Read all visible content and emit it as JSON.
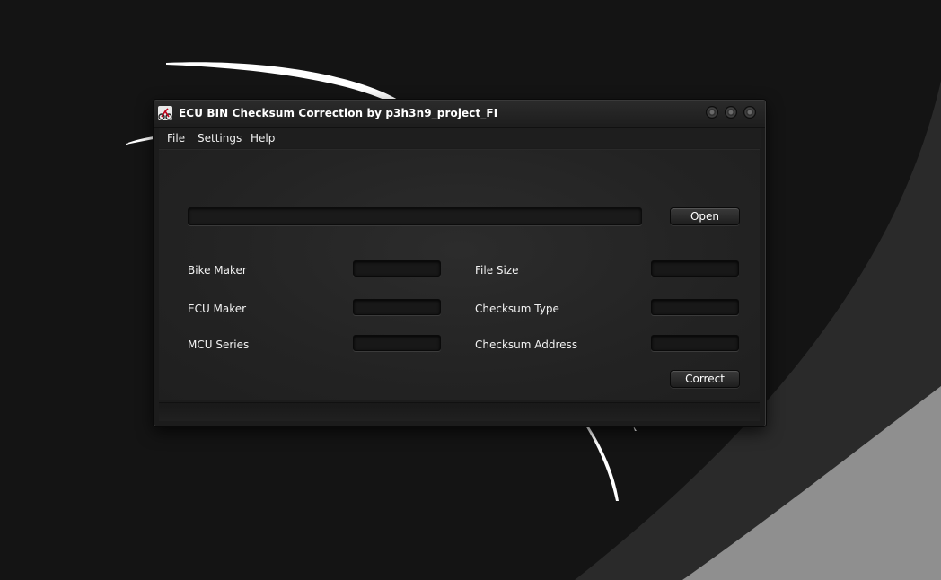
{
  "window": {
    "title": "ECU BIN Checksum Correction by p3h3n9_project_FI"
  },
  "menu": {
    "items": [
      {
        "label": "File"
      },
      {
        "label": "Settings"
      },
      {
        "label": "Help"
      }
    ]
  },
  "file_panel": {
    "path_value": "",
    "open_label": "Open"
  },
  "fields": {
    "bike_maker": {
      "label": "Bike Maker",
      "value": ""
    },
    "ecu_maker": {
      "label": "ECU Maker",
      "value": ""
    },
    "mcu_series": {
      "label": "MCU Series",
      "value": ""
    },
    "file_size": {
      "label": "File Size",
      "value": ""
    },
    "checksum_type": {
      "label": "Checksum Type",
      "value": ""
    },
    "checksum_address": {
      "label": "Checksum Address",
      "value": ""
    }
  },
  "actions": {
    "correct_label": "Correct"
  },
  "status": {
    "text": ""
  },
  "icons": {
    "app": "motorbike-icon",
    "window_buttons": [
      "minimize-icon",
      "maximize-icon",
      "close-icon"
    ]
  },
  "colors": {
    "desktop_bg": "#141414",
    "window_bg": "#1c1c1c",
    "text": "#ffffff"
  }
}
